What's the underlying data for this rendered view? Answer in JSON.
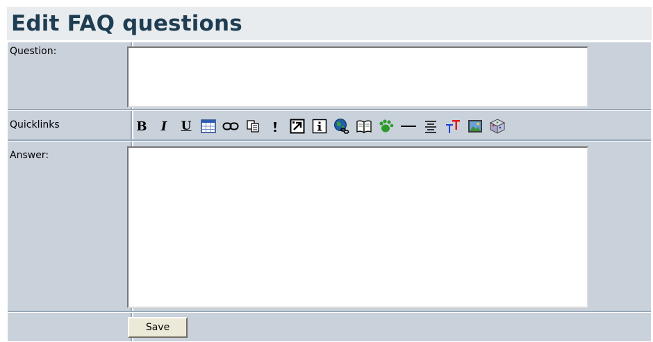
{
  "page": {
    "title": "Edit FAQ questions"
  },
  "form": {
    "question_label": "Question:",
    "quicklinks_label": "Quicklinks",
    "answer_label": "Answer:",
    "question_value": "",
    "answer_value": "",
    "save_label": "Save"
  },
  "toolbar": {
    "bold_label": "B",
    "italic_label": "I",
    "underline_label": "U",
    "icons": [
      "bold-icon",
      "italic-icon",
      "underline-icon",
      "table-icon",
      "link-icon",
      "copy-icon",
      "exclamation-icon",
      "external-link-icon",
      "info-icon",
      "globe-link-icon",
      "book-icon",
      "paw-icon",
      "horizontal-rule-icon",
      "align-center-icon",
      "font-size-icon",
      "image-icon",
      "cube-icon"
    ]
  },
  "colors": {
    "title_bg": "#e8ecef",
    "title_text": "#1f3d52",
    "table_bg": "#c9d1db",
    "button_bg": "#ece9d8"
  }
}
